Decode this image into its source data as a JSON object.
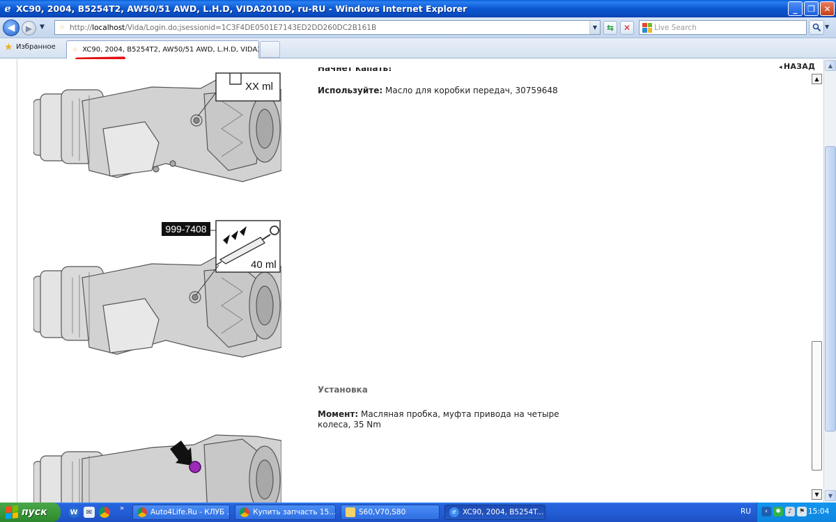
{
  "window": {
    "title": "XC90, 2004, B5254T2, AW50/51 AWD, L.H.D, VIDA2010D, ru-RU - Windows Internet Explorer",
    "app_icon": "ie-icon",
    "controls": {
      "minimize": "_",
      "maximize": "❐",
      "close": "✕"
    }
  },
  "navbar": {
    "url_prefix": "http://",
    "url_host": "localhost",
    "url_rest": "/Vida/Login.do;jsessionid=1C3F4DE0501E7143ED2DD260DC2B161B",
    "search_placeholder": "Live Search"
  },
  "tabs": {
    "favorites_label": "Избранное",
    "active_tab_label": "XC90, 2004, B5254T2, AW50/51 AWD, L.H.D, VIDA2..."
  },
  "page": {
    "back_label": "НАЗАД",
    "cut_line_text": "Начнет капать!",
    "use_label": "Используйте:",
    "use_value": " Масло для коробки передач, 30759648",
    "section_title": "Установка",
    "torque_label": "Момент:",
    "torque_value_line1": " Масляная пробка, муфта привода на четыре",
    "torque_value_line2": "колеса, 35 Nm",
    "figure1_label": "XX ml",
    "figure2_tool": "999-7408",
    "figure2_label": "40 ml"
  },
  "taskbar": {
    "start_label": "пуск",
    "tasks": [
      {
        "label": "Auto4Life.Ru - КЛУБ ...",
        "icon": "chrome-icon"
      },
      {
        "label": "Купить запчасть 15...",
        "icon": "chrome-icon"
      },
      {
        "label": "S60,V70,S80",
        "icon": "folder-icon"
      },
      {
        "label": "XC90, 2004, B5254T...",
        "icon": "ie-icon"
      }
    ],
    "language": "RU",
    "clock": "15:04"
  },
  "colors": {
    "titlebar": "#0b57d0",
    "taskbar": "#245ed5",
    "start_button": "#3a9a3a",
    "red_annotation": "#e41010",
    "plug_marker": "#9b2bb8"
  }
}
